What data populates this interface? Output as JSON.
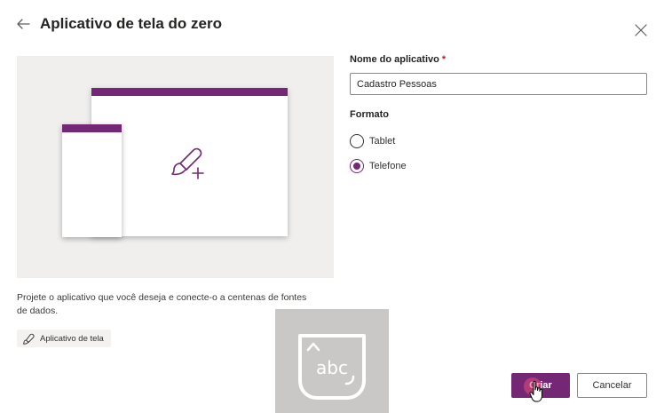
{
  "header": {
    "title": "Aplicativo de tela do zero",
    "back_icon": "arrow-left-icon",
    "close_icon": "close-icon"
  },
  "preview": {
    "description": "Projete o aplicativo que você deseja e conecte-o a centenas de fontes de dados.",
    "chip_label": "Aplicativo de tela",
    "chip_icon": "paintbrush-icon",
    "accent_color": "#742774",
    "background_color": "#f0efee"
  },
  "form": {
    "name_label": "Nome do aplicativo",
    "required_marker": "*",
    "name_value": "Cadastro Pessoas",
    "format_label": "Formato",
    "format_options": [
      {
        "label": "Tablet",
        "checked": false
      },
      {
        "label": "Telefone",
        "checked": true
      }
    ]
  },
  "keyboard_overlay": {
    "text": "abc",
    "icon": "on-screen-keyboard-icon"
  },
  "footer": {
    "create_label": "Criar",
    "cancel_label": "Cancelar",
    "primary_color": "#742774"
  }
}
